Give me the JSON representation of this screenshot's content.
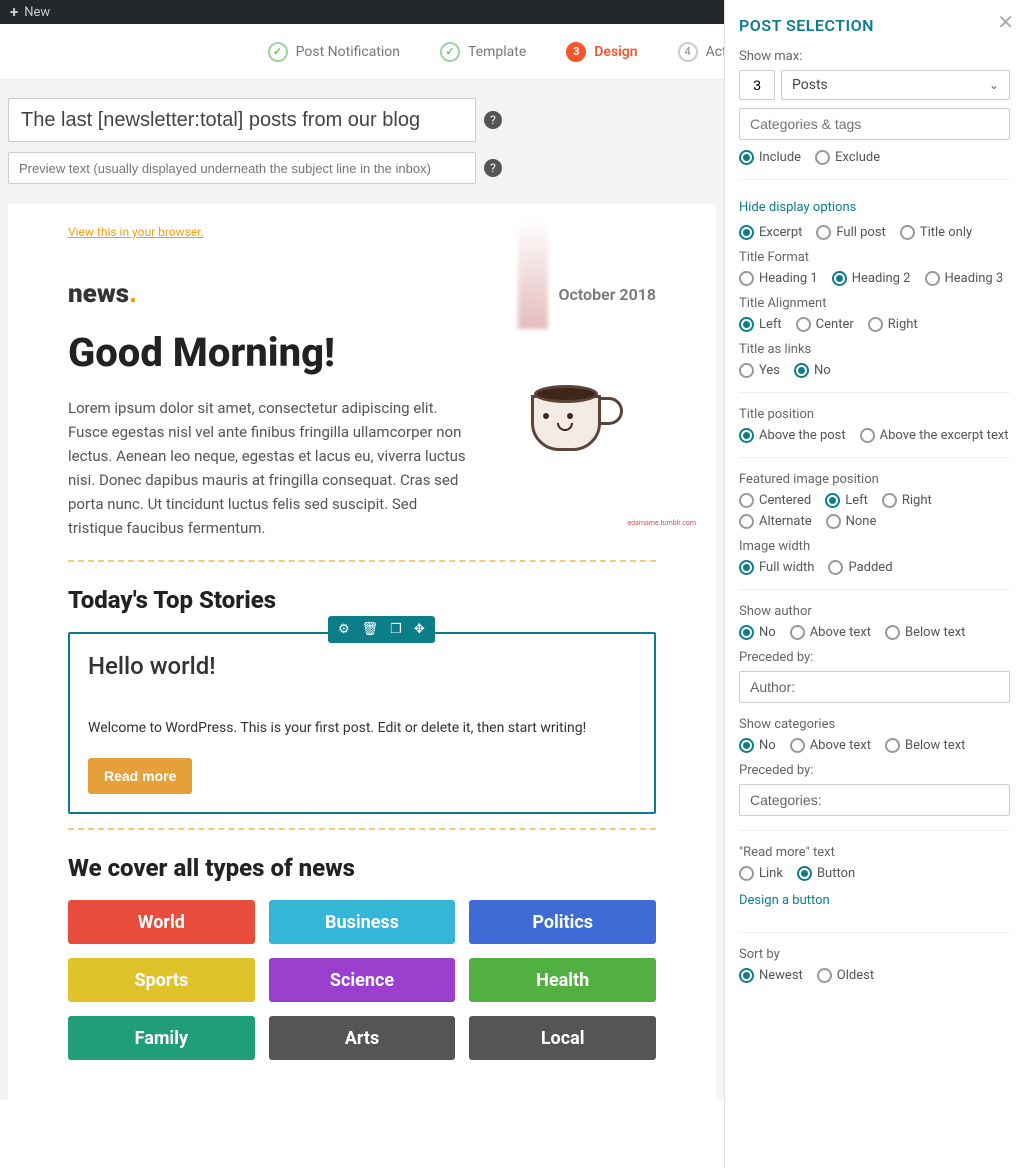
{
  "adminbar": {
    "new_label": "New"
  },
  "steps": [
    {
      "label": "Post Notification",
      "mark": "✓"
    },
    {
      "label": "Template",
      "mark": "✓"
    },
    {
      "label": "Design",
      "mark": "3"
    },
    {
      "label": "Activate",
      "mark": "4"
    }
  ],
  "subject": {
    "value": "The last [newsletter:total] posts from our blog"
  },
  "preview": {
    "placeholder": "Preview text (usually displayed underneath the subject line in the inbox)"
  },
  "canvas": {
    "view_browser": "View this in your browser.",
    "brand": "news",
    "brand_dot": ".",
    "date": "October 2018",
    "hero_title": "Good Morning!",
    "hero_body": "Lorem ipsum dolor sit amet, consectetur adipiscing elit. Fusce egestas nisl vel ante finibus fringilla ullamcorper non lectus. Aenean leo neque, egestas et lacus eu, viverra luctus nisi. Donec dapibus mauris at fringilla consequat. Cras sed porta nunc. Ut tincidunt luctus felis sed suscipit. Sed tristique faucibus fermentum.",
    "hero_credit": "edamame.tumblr.com",
    "top_stories": "Today's Top Stories",
    "post": {
      "title": "Hello world!",
      "body": "Welcome to WordPress. This is your first post. Edit or delete it, then start writing!",
      "read_more": "Read more"
    },
    "cover_title": "We cover all types of news",
    "categories": [
      {
        "label": "World",
        "color": "#e74c3c"
      },
      {
        "label": "Business",
        "color": "#35b5d7"
      },
      {
        "label": "Politics",
        "color": "#3f6bd6"
      },
      {
        "label": "Sports",
        "color": "#e0c22a"
      },
      {
        "label": "Science",
        "color": "#9b3fcf"
      },
      {
        "label": "Health",
        "color": "#52b043"
      },
      {
        "label": "Family",
        "color": "#1f9e78"
      },
      {
        "label": "Arts",
        "color": "#555555"
      },
      {
        "label": "Local",
        "color": "#555555"
      }
    ]
  },
  "panel": {
    "title": "POST SELECTION",
    "show_max_label": "Show max:",
    "show_max_value": "3",
    "show_max_unit": "Posts",
    "tags_placeholder": "Categories & tags",
    "include": "Include",
    "exclude": "Exclude",
    "hide_display": "Hide display options",
    "excerpt": "Excerpt",
    "full_post": "Full post",
    "title_only": "Title only",
    "title_format": "Title Format",
    "h1": "Heading 1",
    "h2": "Heading 2",
    "h3": "Heading 3",
    "title_align": "Title Alignment",
    "left": "Left",
    "center": "Center",
    "right": "Right",
    "title_links": "Title as links",
    "yes": "Yes",
    "no": "No",
    "title_pos": "Title position",
    "above_post": "Above the post",
    "above_excerpt": "Above the excerpt text",
    "feat_img": "Featured image position",
    "centered": "Centered",
    "alternate": "Alternate",
    "none": "None",
    "img_width": "Image width",
    "full_width": "Full width",
    "padded": "Padded",
    "show_author": "Show author",
    "no2": "No",
    "above_text": "Above text",
    "below_text": "Below text",
    "preceded_by": "Preceded by:",
    "author_val": "Author:",
    "show_cats": "Show categories",
    "cats_val": "Categories:",
    "read_more_text": "\"Read more\" text",
    "link": "Link",
    "button": "Button",
    "design_button": "Design a button",
    "sort_by": "Sort by",
    "newest": "Newest",
    "oldest": "Oldest"
  }
}
